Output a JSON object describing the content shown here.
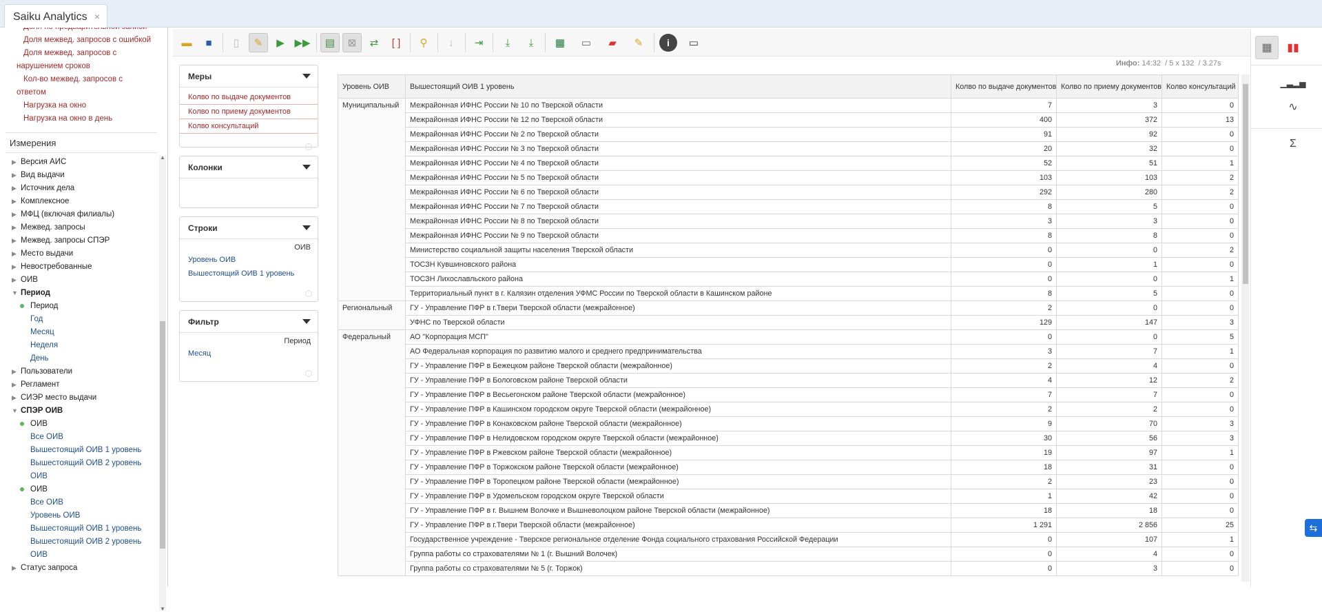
{
  "browser": {
    "tab_title": "Saiku Analytics",
    "tab_close": "×"
  },
  "sidebar": {
    "measures": [
      "Доля по предварительной записи",
      "Доля межвед. запросов с ошибкой",
      "Доля межвед. запросов с",
      "нарушением сроков",
      "Кол-во межвед. запросов с",
      "ответом",
      "Нагрузка на окно",
      "Нагрузка на окно в день"
    ],
    "dimensions_title": "Измерения",
    "dimensions": [
      {
        "label": "Версия АИС",
        "kind": "dim"
      },
      {
        "label": "Вид выдачи",
        "kind": "dim"
      },
      {
        "label": "Источник дела",
        "kind": "dim"
      },
      {
        "label": "Комплексное",
        "kind": "dim"
      },
      {
        "label": "МФЦ (включая филиалы)",
        "kind": "dim"
      },
      {
        "label": "Межвед. запросы",
        "kind": "dim"
      },
      {
        "label": "Межвед. запросы СПЭР",
        "kind": "dim"
      },
      {
        "label": "Место выдачи",
        "kind": "dim"
      },
      {
        "label": "Невостребованные",
        "kind": "dim"
      },
      {
        "label": "ОИВ",
        "kind": "dim"
      },
      {
        "label": "Период",
        "kind": "open"
      },
      {
        "label": "Период",
        "kind": "hier"
      },
      {
        "label": "Год",
        "kind": "level"
      },
      {
        "label": "Месяц",
        "kind": "level"
      },
      {
        "label": "Неделя",
        "kind": "level"
      },
      {
        "label": "День",
        "kind": "level"
      },
      {
        "label": "Пользователи",
        "kind": "dim"
      },
      {
        "label": "Регламент",
        "kind": "dim"
      },
      {
        "label": "СИЭР место выдачи",
        "kind": "dim"
      },
      {
        "label": "СПЭР ОИВ",
        "kind": "open"
      },
      {
        "label": "ОИВ",
        "kind": "hier"
      },
      {
        "label": "Все ОИВ",
        "kind": "level"
      },
      {
        "label": "Вышестоящий ОИВ 1 уровень",
        "kind": "level"
      },
      {
        "label": "Вышестоящий ОИВ 2 уровень",
        "kind": "level"
      },
      {
        "label": "ОИВ",
        "kind": "level"
      },
      {
        "label": "ОИВ",
        "kind": "hier"
      },
      {
        "label": "Все ОИВ",
        "kind": "level"
      },
      {
        "label": "Уровень ОИВ",
        "kind": "level"
      },
      {
        "label": "Вышестоящий ОИВ 1 уровень",
        "kind": "level"
      },
      {
        "label": "Вышестоящий ОИВ 2 уровень",
        "kind": "level"
      },
      {
        "label": "ОИВ",
        "kind": "level"
      },
      {
        "label": "Статус запроса",
        "kind": "dim"
      }
    ]
  },
  "panels": {
    "measures": {
      "title": "Меры",
      "items": [
        "Колво по выдаче документов",
        "Колво по приему документов",
        "Колво консультаций"
      ]
    },
    "columns": {
      "title": "Колонки"
    },
    "rows": {
      "title": "Строки",
      "dimension": "ОИВ",
      "items": [
        "Уровень ОИВ",
        "Вышестоящий ОИВ 1 уровень"
      ]
    },
    "filter": {
      "title": "Фильтр",
      "dimension": "Период",
      "items": [
        "Месяц"
      ]
    }
  },
  "info": {
    "text": "Инфо:",
    "time": "14:32",
    "size": "/ 5 x 132",
    "duration": "/ 3.27s"
  },
  "table": {
    "headers": [
      "Уровень ОИВ",
      "Вышестоящий ОИВ 1 уровень",
      "Колво по выдаче документов",
      "Колво по приему документов",
      "Колво консультаций"
    ],
    "groups": [
      {
        "level": "Муниципальный",
        "rows": [
          [
            "Межрайонная ИФНС России № 10 по Тверской области",
            "7",
            "3",
            "0"
          ],
          [
            "Межрайонная ИФНС России № 12 по Тверской области",
            "400",
            "372",
            "13"
          ],
          [
            "Межрайонная ИФНС России № 2 по Тверской области",
            "91",
            "92",
            "0"
          ],
          [
            "Межрайонная ИФНС России № 3 по Тверской области",
            "20",
            "32",
            "0"
          ],
          [
            "Межрайонная ИФНС России № 4 по Тверской области",
            "52",
            "51",
            "1"
          ],
          [
            "Межрайонная ИФНС России № 5 по Тверской области",
            "103",
            "103",
            "2"
          ],
          [
            "Межрайонная ИФНС России № 6 по Тверской области",
            "292",
            "280",
            "2"
          ],
          [
            "Межрайонная ИФНС России № 7 по Тверской области",
            "8",
            "5",
            "0"
          ],
          [
            "Межрайонная ИФНС России № 8 по Тверской области",
            "3",
            "3",
            "0"
          ],
          [
            "Межрайонная ИФНС России № 9 по Тверской области",
            "8",
            "8",
            "0"
          ],
          [
            "Министерство социальной защиты населения Тверской области",
            "0",
            "0",
            "2"
          ],
          [
            "ТОСЗН Кувшиновского района",
            "0",
            "1",
            "0"
          ],
          [
            "ТОСЗН Лихославльского района",
            "0",
            "0",
            "1"
          ],
          [
            "Территориальный пункт в г. Калязин отделения УФМС России по Тверской области в Кашинском районе",
            "8",
            "5",
            "0"
          ]
        ]
      },
      {
        "level": "Региональный",
        "rows": [
          [
            "ГУ - Управление ПФР в г.Твери Тверской области (межрайонное)",
            "2",
            "0",
            "0"
          ],
          [
            "УФНС по Тверской области",
            "129",
            "147",
            "3"
          ]
        ]
      },
      {
        "level": "Федеральный",
        "rows": [
          [
            "АО \"Корпорация МСП\"",
            "0",
            "0",
            "5"
          ],
          [
            "АО Федеральная корпорация по развитию малого и среднего предпринимательства",
            "3",
            "7",
            "1"
          ],
          [
            "ГУ - Управление ПФР в Бежецком районе Тверской области (межрайонное)",
            "2",
            "4",
            "0"
          ],
          [
            "ГУ - Управление ПФР в Бологовском районе Тверской области",
            "4",
            "12",
            "2"
          ],
          [
            "ГУ - Управление ПФР в Весьегонском районе Тверской области (межрайонное)",
            "7",
            "7",
            "0"
          ],
          [
            "ГУ - Управление ПФР в Кашинском городском округе Тверской области (межрайонное)",
            "2",
            "2",
            "0"
          ],
          [
            "ГУ - Управление ПФР в Конаковском районе Тверской области (межрайонное)",
            "9",
            "70",
            "3"
          ],
          [
            "ГУ - Управление ПФР в Нелидовском городском округе Тверской области (межрайонное)",
            "30",
            "56",
            "3"
          ],
          [
            "ГУ - Управление ПФР в Ржевском районе Тверской области (межрайонное)",
            "19",
            "97",
            "1"
          ],
          [
            "ГУ - Управление ПФР в Торжокском районе Тверской области (межрайонное)",
            "18",
            "31",
            "0"
          ],
          [
            "ГУ - Управление ПФР в Торопецком районе Тверской области (межрайонное)",
            "2",
            "23",
            "0"
          ],
          [
            "ГУ - Управление ПФР в Удомельском городском округе Тверской области",
            "1",
            "42",
            "0"
          ],
          [
            "ГУ - Управление ПФР в г. Вышнем Волочке и Вышневолоцком районе Тверской области (межрайонное)",
            "18",
            "18",
            "0"
          ],
          [
            "ГУ - Управление ПФР в г.Твери Тверской области (межрайонное)",
            "1 291",
            "2 856",
            "25"
          ],
          [
            "Государственное учреждение - Тверское региональное отделение Фонда социального страхования Российской Федерации",
            "0",
            "107",
            "1"
          ],
          [
            "Группа работы со страхователями № 1 (г. Вышний Волочек)",
            "0",
            "4",
            "0"
          ],
          [
            "Группа работы со страхователями № 5 (г. Торжок)",
            "0",
            "3",
            "0"
          ]
        ]
      }
    ]
  }
}
